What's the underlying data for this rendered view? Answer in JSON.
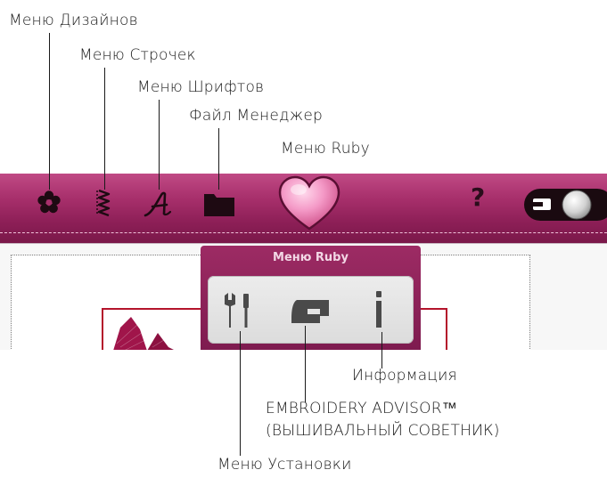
{
  "callouts": {
    "design_menu": "Меню Дизайнов",
    "stitch_menu": "Меню Строчек",
    "font_menu": "Меню Шрифтов",
    "file_manager": "Файл Менеджер",
    "ruby_menu": "Меню Ruby",
    "info": "Информация",
    "embroidery_advisor": "EMBROIDERY ADVISOR™",
    "embroidery_advisor_ru": "(ВЫШИВАЛЬНЫЙ СОВЕТНИК)",
    "setup_menu": "Меню Установки"
  },
  "toolbar": {
    "help_label": "?",
    "icons": [
      "flower-icon",
      "zigzag-stitch-icon",
      "script-a-icon",
      "folder-icon",
      "heart-icon",
      "help-icon",
      "toggle-switch-icon"
    ]
  },
  "ruby_popup": {
    "title": "Меню Ruby",
    "icons": [
      "setup-tools-icon",
      "sewing-machine-icon",
      "info-icon"
    ]
  },
  "colors": {
    "toolbar": "#9a2862",
    "popup": "#8a2158",
    "hoop": "#b4142b",
    "heart": "#ef96c4"
  }
}
